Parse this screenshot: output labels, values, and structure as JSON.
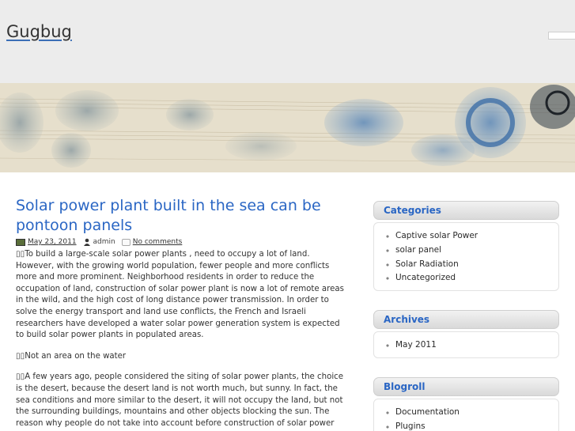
{
  "site": {
    "title": "Gugbug"
  },
  "post": {
    "title": "Solar power plant built in the sea can be pontoon panels",
    "date": "May 23, 2011",
    "author": "admin",
    "comments": "No comments",
    "paragraphs": [
      "▯▯To build a large-scale solar power plants , need to occupy a lot of land. However, with the growing world population, fewer people and more conflicts more and more prominent. Neighborhood residents in order to reduce the occupation of land, construction of solar power plant is now a lot of remote areas in the wild, and the high cost of long distance power transmission. In order to solve the energy transport and land use conflicts, the French and Israeli researchers have developed a water solar power generation system is expected to build solar power plants in populated areas.",
      "▯▯Not an area on the water",
      "▯▯A few years ago, people considered the siting of solar power plants, the choice is the desert, because the desert land is not worth much, but sunny. In fact, the sea conditions and more similar to the desert, it will not occupy the land, but not the surrounding buildings, mountains and other objects blocking the sun. The reason why people do not take into account before construction of solar power"
    ]
  },
  "sidebar": {
    "categories": {
      "title": "Categories",
      "items": [
        "Captive solar Power",
        "solar panel",
        "Solar Radiation",
        "Uncategorized"
      ]
    },
    "archives": {
      "title": "Archives",
      "items": [
        "May 2011"
      ]
    },
    "blogroll": {
      "title": "Blogroll",
      "items": [
        "Documentation",
        "Plugins"
      ]
    }
  },
  "colors": {
    "link": "#2a66c4",
    "header_bg": "#ececec"
  }
}
